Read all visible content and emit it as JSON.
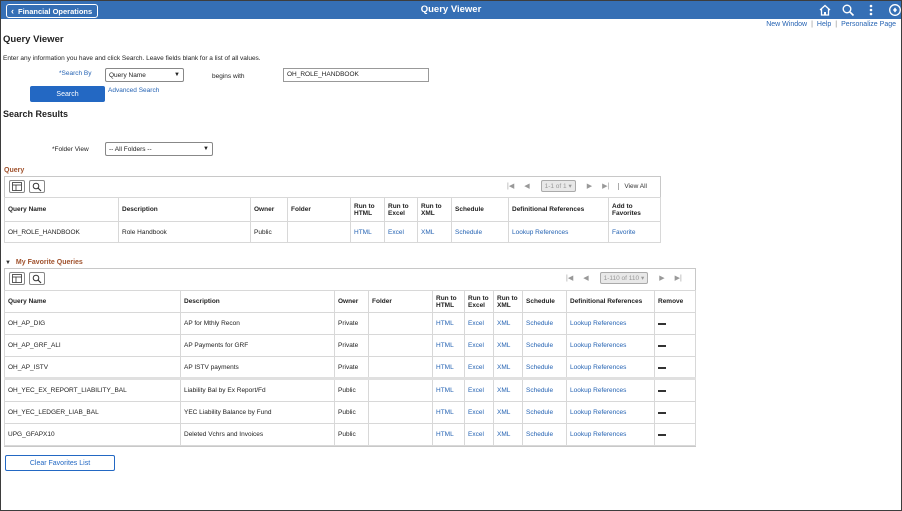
{
  "header": {
    "back_label": "Financial Operations",
    "title": "Query Viewer"
  },
  "toplinks": {
    "new_window": "New Window",
    "help": "Help",
    "personalize": "Personalize Page"
  },
  "page": {
    "title": "Query Viewer",
    "instructions": "Enter any information you have and click Search. Leave fields blank for a list of all values."
  },
  "search": {
    "by_label": "*Search By",
    "by_value": "Query Name",
    "operator_label": "begins with",
    "value": "OH_ROLE_HANDBOOK",
    "button": "Search",
    "advanced": "Advanced Search"
  },
  "results": {
    "title": "Search Results",
    "folder_label": "*Folder View",
    "folder_value": "-- All Folders --"
  },
  "query_grid": {
    "title": "Query",
    "pager": "1-1 of 1",
    "view_all": "View All",
    "headers": [
      "Query Name",
      "Description",
      "Owner",
      "Folder",
      "Run to HTML",
      "Run to Excel",
      "Run to XML",
      "Schedule",
      "Definitional References",
      "Add to Favorites"
    ],
    "rows": [
      {
        "name": "OH_ROLE_HANDBOOK",
        "desc": "Role Handbook",
        "owner": "Public",
        "folder": "",
        "html": "HTML",
        "excel": "Excel",
        "xml": "XML",
        "schedule": "Schedule",
        "refs": "Lookup References",
        "fav": "Favorite"
      }
    ]
  },
  "fav_grid": {
    "title": "My Favorite Queries",
    "pager": "1-110 of 110",
    "headers": [
      "Query Name",
      "Description",
      "Owner",
      "Folder",
      "Run to HTML",
      "Run to Excel",
      "Run to XML",
      "Schedule",
      "Definitional References",
      "Remove"
    ],
    "rows": [
      {
        "name": "OH_AP_DIG",
        "desc": "AP for Mthly Recon",
        "owner": "Private",
        "html": "HTML",
        "excel": "Excel",
        "xml": "XML",
        "schedule": "Schedule",
        "refs": "Lookup References"
      },
      {
        "name": "OH_AP_GRF_ALI",
        "desc": "AP Payments for GRF",
        "owner": "Private",
        "html": "HTML",
        "excel": "Excel",
        "xml": "XML",
        "schedule": "Schedule",
        "refs": "Lookup References"
      },
      {
        "name": "OH_AP_ISTV",
        "desc": "AP ISTV payments",
        "owner": "Private",
        "html": "HTML",
        "excel": "Excel",
        "xml": "XML",
        "schedule": "Schedule",
        "refs": "Lookup References"
      },
      {
        "name": "OH_YEC_EX_REPORT_LIABILITY_BAL",
        "desc": "Liability Bal by Ex Report/Fd",
        "owner": "Public",
        "html": "HTML",
        "excel": "Excel",
        "xml": "XML",
        "schedule": "Schedule",
        "refs": "Lookup References"
      },
      {
        "name": "OH_YEC_LEDGER_LIAB_BAL",
        "desc": "YEC Liability Balance by Fund",
        "owner": "Public",
        "html": "HTML",
        "excel": "Excel",
        "xml": "XML",
        "schedule": "Schedule",
        "refs": "Lookup References"
      },
      {
        "name": "UPG_GFAPX10",
        "desc": "Deleted Vchrs and Invoices",
        "owner": "Public",
        "html": "HTML",
        "excel": "Excel",
        "xml": "XML",
        "schedule": "Schedule",
        "refs": "Lookup References"
      }
    ],
    "clear_button": "Clear Favorites List"
  },
  "colors": {
    "brand": "#356fb5",
    "primary_button": "#2368c3",
    "link": "#2563b3",
    "section_title": "#a0522d"
  }
}
